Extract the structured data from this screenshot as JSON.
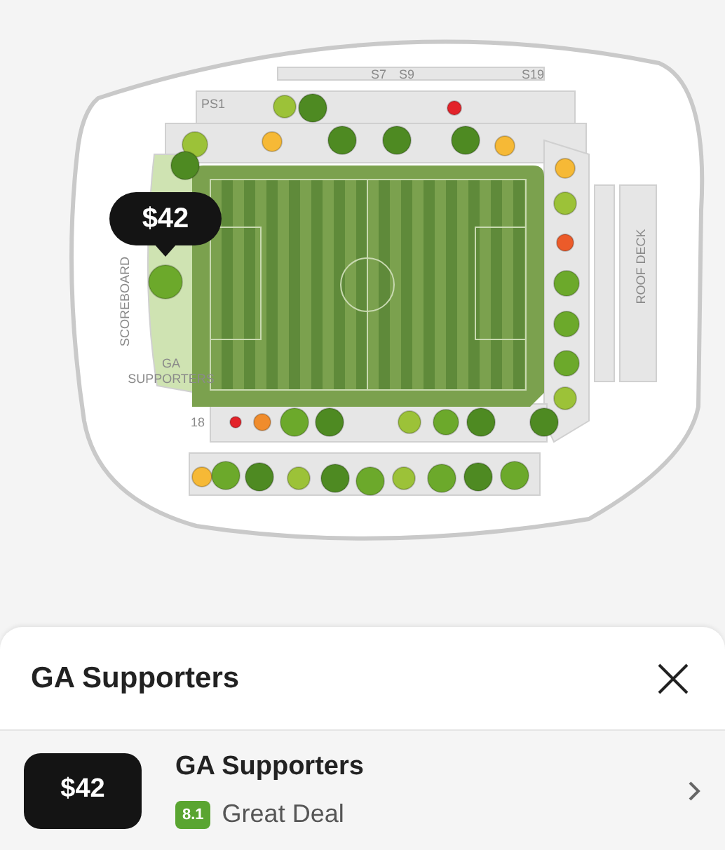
{
  "map": {
    "labels": [
      "S7",
      "S9",
      "S19",
      "PS1",
      "SCOREBOARD",
      "GA",
      "SUPPORTERS",
      "ROOF DECK",
      "18"
    ],
    "tooltip": "$42",
    "sections": [
      {
        "color": "#9cc238"
      },
      {
        "color": "#4e8a22"
      },
      {
        "color": "#e3232a"
      },
      {
        "color": "#9cc238"
      },
      {
        "color": "#4e8a22"
      },
      {
        "color": "#f6b936"
      },
      {
        "color": "#4e8a22"
      },
      {
        "color": "#4e8a22"
      },
      {
        "color": "#4e8a22"
      },
      {
        "color": "#f6b936"
      },
      {
        "color": "#f6b936"
      },
      {
        "color": "#9cc238"
      },
      {
        "color": "#ec5b2a"
      },
      {
        "color": "#6ca92b"
      },
      {
        "color": "#6ca92b"
      },
      {
        "color": "#6ca92b"
      },
      {
        "color": "#9cc238"
      },
      {
        "color": "#4e8a22"
      },
      {
        "color": "#6ca92b"
      },
      {
        "color": "#e3232a"
      },
      {
        "color": "#f08c2c"
      },
      {
        "color": "#6ca92b"
      },
      {
        "color": "#4e8a22"
      },
      {
        "color": "#9cc238"
      },
      {
        "color": "#6ca92b"
      },
      {
        "color": "#4e8a22"
      },
      {
        "color": "#f6b936"
      },
      {
        "color": "#6ca92b"
      },
      {
        "color": "#4e8a22"
      },
      {
        "color": "#9cc238"
      },
      {
        "color": "#4e8a22"
      },
      {
        "color": "#6ca92b"
      },
      {
        "color": "#9cc238"
      },
      {
        "color": "#6ca92b"
      },
      {
        "color": "#4e8a22"
      },
      {
        "color": "#6ca92b"
      }
    ]
  },
  "sheet": {
    "title": "GA Supporters",
    "listings": [
      {
        "price": "$42",
        "section": "GA Supporters",
        "score": "8.1",
        "rating": "Great Deal"
      }
    ]
  }
}
